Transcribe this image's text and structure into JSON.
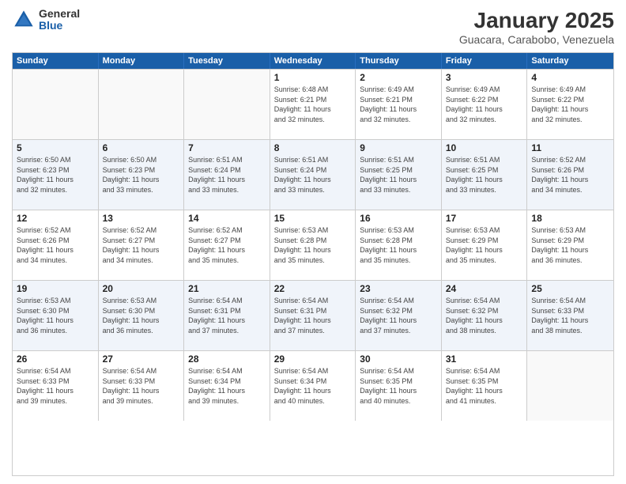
{
  "header": {
    "logo_general": "General",
    "logo_blue": "Blue",
    "month_title": "January 2025",
    "location": "Guacara, Carabobo, Venezuela"
  },
  "weekdays": [
    "Sunday",
    "Monday",
    "Tuesday",
    "Wednesday",
    "Thursday",
    "Friday",
    "Saturday"
  ],
  "weeks": [
    {
      "alt": false,
      "days": [
        {
          "num": "",
          "info": ""
        },
        {
          "num": "",
          "info": ""
        },
        {
          "num": "",
          "info": ""
        },
        {
          "num": "1",
          "info": "Sunrise: 6:48 AM\nSunset: 6:21 PM\nDaylight: 11 hours\nand 32 minutes."
        },
        {
          "num": "2",
          "info": "Sunrise: 6:49 AM\nSunset: 6:21 PM\nDaylight: 11 hours\nand 32 minutes."
        },
        {
          "num": "3",
          "info": "Sunrise: 6:49 AM\nSunset: 6:22 PM\nDaylight: 11 hours\nand 32 minutes."
        },
        {
          "num": "4",
          "info": "Sunrise: 6:49 AM\nSunset: 6:22 PM\nDaylight: 11 hours\nand 32 minutes."
        }
      ]
    },
    {
      "alt": true,
      "days": [
        {
          "num": "5",
          "info": "Sunrise: 6:50 AM\nSunset: 6:23 PM\nDaylight: 11 hours\nand 32 minutes."
        },
        {
          "num": "6",
          "info": "Sunrise: 6:50 AM\nSunset: 6:23 PM\nDaylight: 11 hours\nand 33 minutes."
        },
        {
          "num": "7",
          "info": "Sunrise: 6:51 AM\nSunset: 6:24 PM\nDaylight: 11 hours\nand 33 minutes."
        },
        {
          "num": "8",
          "info": "Sunrise: 6:51 AM\nSunset: 6:24 PM\nDaylight: 11 hours\nand 33 minutes."
        },
        {
          "num": "9",
          "info": "Sunrise: 6:51 AM\nSunset: 6:25 PM\nDaylight: 11 hours\nand 33 minutes."
        },
        {
          "num": "10",
          "info": "Sunrise: 6:51 AM\nSunset: 6:25 PM\nDaylight: 11 hours\nand 33 minutes."
        },
        {
          "num": "11",
          "info": "Sunrise: 6:52 AM\nSunset: 6:26 PM\nDaylight: 11 hours\nand 34 minutes."
        }
      ]
    },
    {
      "alt": false,
      "days": [
        {
          "num": "12",
          "info": "Sunrise: 6:52 AM\nSunset: 6:26 PM\nDaylight: 11 hours\nand 34 minutes."
        },
        {
          "num": "13",
          "info": "Sunrise: 6:52 AM\nSunset: 6:27 PM\nDaylight: 11 hours\nand 34 minutes."
        },
        {
          "num": "14",
          "info": "Sunrise: 6:52 AM\nSunset: 6:27 PM\nDaylight: 11 hours\nand 35 minutes."
        },
        {
          "num": "15",
          "info": "Sunrise: 6:53 AM\nSunset: 6:28 PM\nDaylight: 11 hours\nand 35 minutes."
        },
        {
          "num": "16",
          "info": "Sunrise: 6:53 AM\nSunset: 6:28 PM\nDaylight: 11 hours\nand 35 minutes."
        },
        {
          "num": "17",
          "info": "Sunrise: 6:53 AM\nSunset: 6:29 PM\nDaylight: 11 hours\nand 35 minutes."
        },
        {
          "num": "18",
          "info": "Sunrise: 6:53 AM\nSunset: 6:29 PM\nDaylight: 11 hours\nand 36 minutes."
        }
      ]
    },
    {
      "alt": true,
      "days": [
        {
          "num": "19",
          "info": "Sunrise: 6:53 AM\nSunset: 6:30 PM\nDaylight: 11 hours\nand 36 minutes."
        },
        {
          "num": "20",
          "info": "Sunrise: 6:53 AM\nSunset: 6:30 PM\nDaylight: 11 hours\nand 36 minutes."
        },
        {
          "num": "21",
          "info": "Sunrise: 6:54 AM\nSunset: 6:31 PM\nDaylight: 11 hours\nand 37 minutes."
        },
        {
          "num": "22",
          "info": "Sunrise: 6:54 AM\nSunset: 6:31 PM\nDaylight: 11 hours\nand 37 minutes."
        },
        {
          "num": "23",
          "info": "Sunrise: 6:54 AM\nSunset: 6:32 PM\nDaylight: 11 hours\nand 37 minutes."
        },
        {
          "num": "24",
          "info": "Sunrise: 6:54 AM\nSunset: 6:32 PM\nDaylight: 11 hours\nand 38 minutes."
        },
        {
          "num": "25",
          "info": "Sunrise: 6:54 AM\nSunset: 6:33 PM\nDaylight: 11 hours\nand 38 minutes."
        }
      ]
    },
    {
      "alt": false,
      "days": [
        {
          "num": "26",
          "info": "Sunrise: 6:54 AM\nSunset: 6:33 PM\nDaylight: 11 hours\nand 39 minutes."
        },
        {
          "num": "27",
          "info": "Sunrise: 6:54 AM\nSunset: 6:33 PM\nDaylight: 11 hours\nand 39 minutes."
        },
        {
          "num": "28",
          "info": "Sunrise: 6:54 AM\nSunset: 6:34 PM\nDaylight: 11 hours\nand 39 minutes."
        },
        {
          "num": "29",
          "info": "Sunrise: 6:54 AM\nSunset: 6:34 PM\nDaylight: 11 hours\nand 40 minutes."
        },
        {
          "num": "30",
          "info": "Sunrise: 6:54 AM\nSunset: 6:35 PM\nDaylight: 11 hours\nand 40 minutes."
        },
        {
          "num": "31",
          "info": "Sunrise: 6:54 AM\nSunset: 6:35 PM\nDaylight: 11 hours\nand 41 minutes."
        },
        {
          "num": "",
          "info": ""
        }
      ]
    }
  ]
}
